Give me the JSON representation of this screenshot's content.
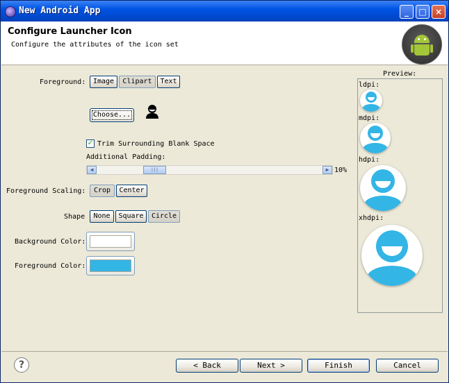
{
  "window": {
    "title": "New Android App"
  },
  "header": {
    "title": "Configure Launcher Icon",
    "subtitle": "Configure the attributes of the icon set"
  },
  "foreground": {
    "label": "Foreground:",
    "options": [
      "Image",
      "Clipart",
      "Text"
    ],
    "selected": "Clipart"
  },
  "choose_button": "Choose...",
  "trim": {
    "label": "Trim Surrounding Blank Space",
    "checked": true
  },
  "padding": {
    "label": "Additional Padding:",
    "value": "10%",
    "level": 0.1
  },
  "scaling": {
    "label": "Foreground Scaling:",
    "options": [
      "Crop",
      "Center"
    ],
    "selected": "Crop"
  },
  "shape": {
    "label": "Shape",
    "options": [
      "None",
      "Square",
      "Circle"
    ],
    "selected": "Circle"
  },
  "background_color": {
    "label": "Background Color:",
    "value": "#ffffff"
  },
  "foreground_color": {
    "label": "Foreground Color:",
    "value": "#33b5e5"
  },
  "preview": {
    "legend": "Preview:",
    "densities": [
      "ldpi:",
      "mdpi:",
      "hdpi:",
      "xhdpi:"
    ]
  },
  "footer": {
    "back": "< Back",
    "next": "Next >",
    "finish": "Finish",
    "cancel": "Cancel",
    "help": "?"
  },
  "colors": {
    "accent": "#33b5e5",
    "titlebar": "#0054e3",
    "face": "#ece9d8"
  }
}
